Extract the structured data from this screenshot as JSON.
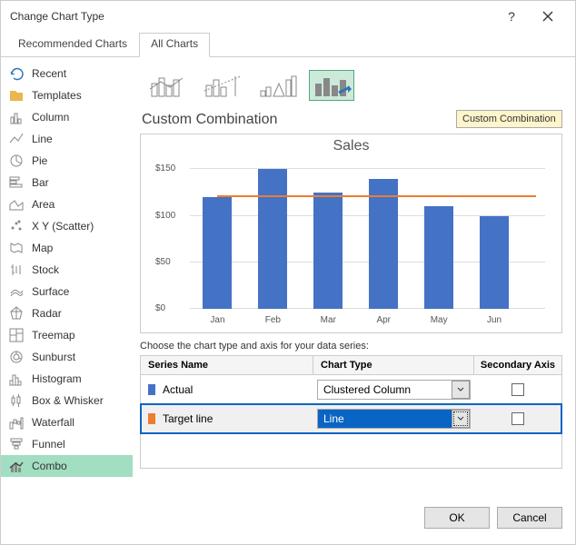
{
  "title": "Change Chart Type",
  "tabs": {
    "recommended": "Recommended Charts",
    "all": "All Charts"
  },
  "sidebar": {
    "items": [
      {
        "label": "Recent",
        "icon": "recent"
      },
      {
        "label": "Templates",
        "icon": "templates"
      },
      {
        "label": "Column",
        "icon": "column"
      },
      {
        "label": "Line",
        "icon": "line"
      },
      {
        "label": "Pie",
        "icon": "pie"
      },
      {
        "label": "Bar",
        "icon": "bar"
      },
      {
        "label": "Area",
        "icon": "area"
      },
      {
        "label": "X Y (Scatter)",
        "icon": "scatter"
      },
      {
        "label": "Map",
        "icon": "map"
      },
      {
        "label": "Stock",
        "icon": "stock"
      },
      {
        "label": "Surface",
        "icon": "surface"
      },
      {
        "label": "Radar",
        "icon": "radar"
      },
      {
        "label": "Treemap",
        "icon": "treemap"
      },
      {
        "label": "Sunburst",
        "icon": "sunburst"
      },
      {
        "label": "Histogram",
        "icon": "histogram"
      },
      {
        "label": "Box & Whisker",
        "icon": "box"
      },
      {
        "label": "Waterfall",
        "icon": "waterfall"
      },
      {
        "label": "Funnel",
        "icon": "funnel"
      },
      {
        "label": "Combo",
        "icon": "combo"
      }
    ]
  },
  "subtype_label": "Custom Combination",
  "tooltip": "Custom Combination",
  "chart_data": {
    "type": "bar",
    "title": "Sales",
    "categories": [
      "Jan",
      "Feb",
      "Mar",
      "Apr",
      "May",
      "Jun"
    ],
    "series": [
      {
        "name": "Actual",
        "type": "bar",
        "values": [
          120,
          150,
          125,
          140,
          110,
          100
        ]
      },
      {
        "name": "Target line",
        "type": "line",
        "values": [
          120,
          120,
          120,
          120,
          120,
          120
        ]
      }
    ],
    "ylim": [
      0,
      160
    ],
    "yticks": [
      0,
      50,
      100,
      150
    ],
    "yticklabels": [
      "$0",
      "$50",
      "$100",
      "$150"
    ]
  },
  "series_instruction": "Choose the chart type and axis for your data series:",
  "series_header": {
    "name": "Series Name",
    "type": "Chart Type",
    "axis": "Secondary Axis"
  },
  "series": [
    {
      "name": "Actual",
      "color": "#4472c4",
      "chart_type": "Clustered Column",
      "secondary": false,
      "selected": false
    },
    {
      "name": "Target line",
      "color": "#ed7d31",
      "chart_type": "Line",
      "secondary": false,
      "selected": true
    }
  ],
  "buttons": {
    "ok": "OK",
    "cancel": "Cancel"
  }
}
